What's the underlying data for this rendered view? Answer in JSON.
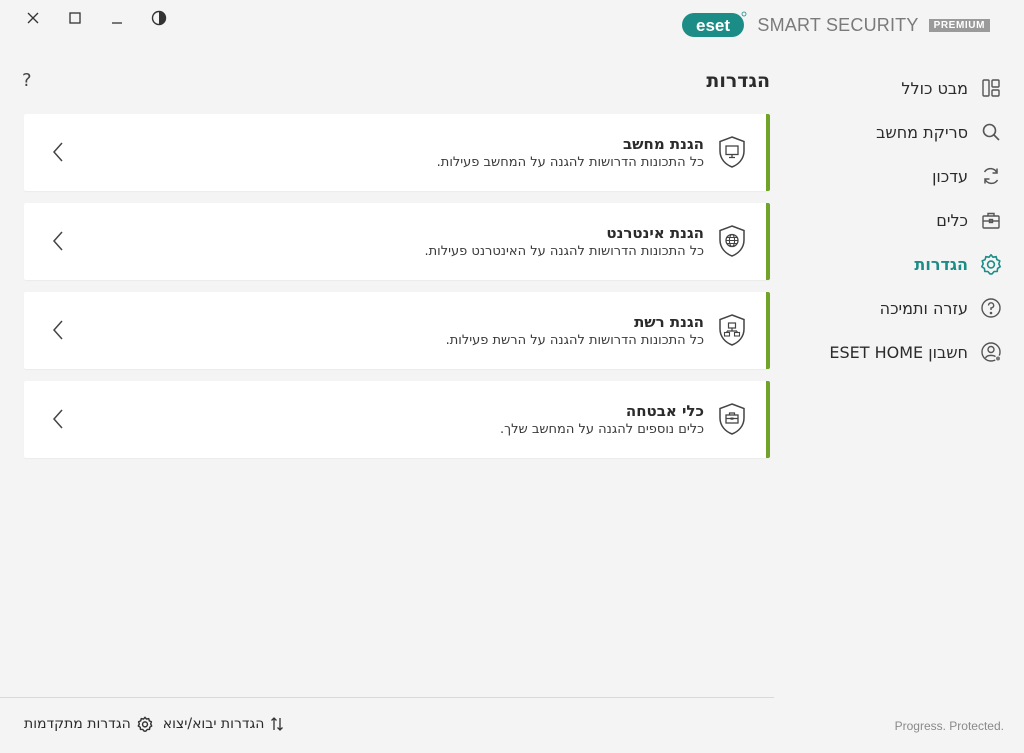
{
  "window": {
    "controls": [
      "close",
      "maximize",
      "minimize",
      "theme"
    ]
  },
  "brand": {
    "logo_text": "eset",
    "name": "SMART SECURITY",
    "badge": "PREMIUM",
    "accent": "#1c8c86"
  },
  "sidebar": {
    "items": [
      {
        "label": "מבט כולל",
        "icon": "dashboard-icon"
      },
      {
        "label": "סריקת מחשב",
        "icon": "search-icon"
      },
      {
        "label": "עדכון",
        "icon": "refresh-icon"
      },
      {
        "label": "כלים",
        "icon": "toolbox-icon"
      },
      {
        "label": "הגדרות",
        "icon": "gear-icon",
        "active": true
      },
      {
        "label": "עזרה ותמיכה",
        "icon": "help-icon"
      },
      {
        "label": "חשבון ESET HOME",
        "icon": "account-icon"
      }
    ]
  },
  "main": {
    "title": "הגדרות",
    "help": "?",
    "cards": [
      {
        "title": "הגנת מחשב",
        "desc": "כל התכונות הדרושות להגנה על המחשב פעילות.",
        "icon": "shield-computer-icon"
      },
      {
        "title": "הגנת אינטרנט",
        "desc": "כל התכונות הדרושות להגנה על האינטרנט פעילות.",
        "icon": "shield-globe-icon"
      },
      {
        "title": "הגנת רשת",
        "desc": "כל התכונות הדרושות להגנה על הרשת פעילות.",
        "icon": "shield-network-icon"
      },
      {
        "title": "כלי אבטחה",
        "desc": "כלים נוספים להגנה על המחשב שלך.",
        "icon": "shield-toolbox-icon"
      }
    ],
    "status_color": "#71a22a"
  },
  "footer": {
    "advanced": "הגדרות מתקדמות",
    "import_export": "הגדרות יבוא/יצוא",
    "tagline": "Progress. Protected."
  }
}
